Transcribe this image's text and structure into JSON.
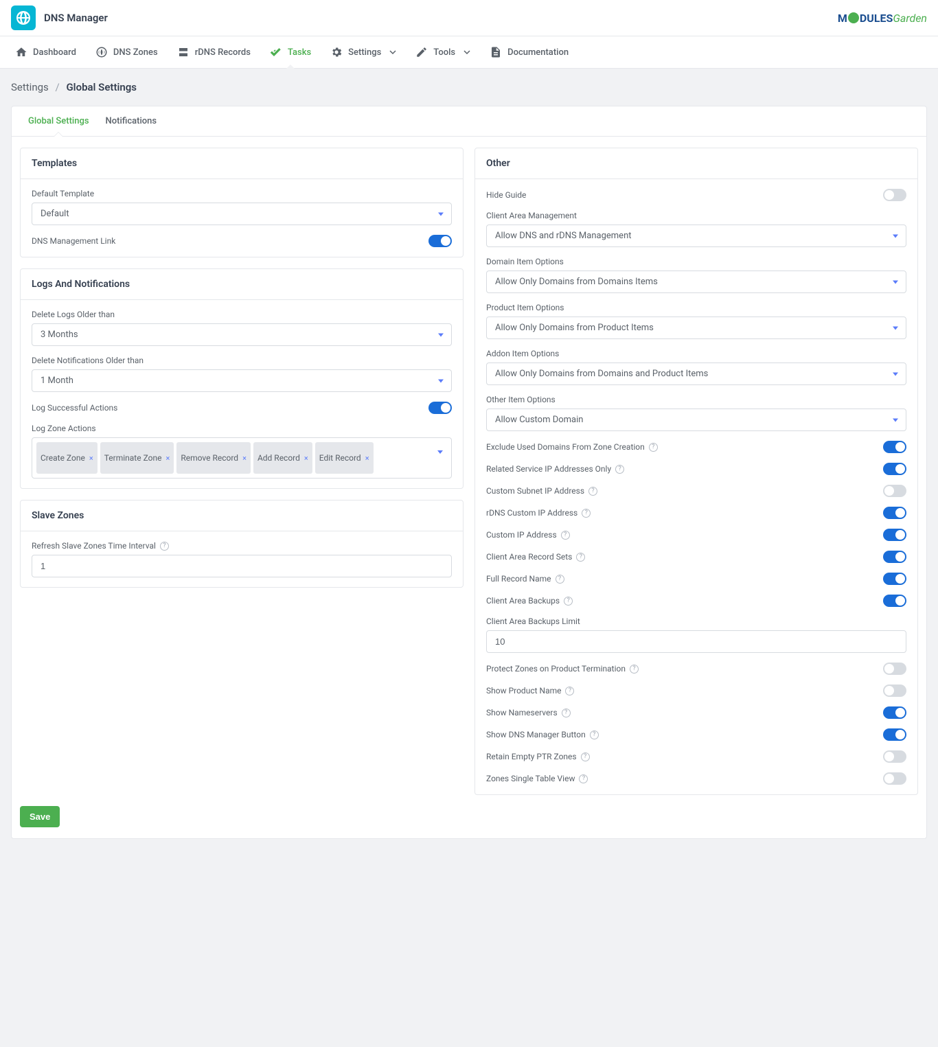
{
  "header": {
    "title": "DNS Manager",
    "logo_text1": "M",
    "logo_text2": "DULES",
    "logo_text3": "Garden"
  },
  "nav": {
    "dashboard": "Dashboard",
    "dns_zones": "DNS Zones",
    "rdns": "rDNS Records",
    "tasks": "Tasks",
    "settings": "Settings",
    "tools": "Tools",
    "docs": "Documentation"
  },
  "breadcrumb": {
    "root": "Settings",
    "current": "Global Settings"
  },
  "tabs": {
    "global": "Global Settings",
    "notifications": "Notifications"
  },
  "templates": {
    "title": "Templates",
    "default_template_label": "Default Template",
    "default_template_value": "Default",
    "dns_link_label": "DNS Management Link"
  },
  "logs": {
    "title": "Logs And Notifications",
    "del_logs_label": "Delete Logs Older than",
    "del_logs_value": "3 Months",
    "del_notif_label": "Delete Notifications Older than",
    "del_notif_value": "1 Month",
    "log_success_label": "Log Successful Actions",
    "log_zone_label": "Log Zone Actions",
    "tags": [
      "Create Zone",
      "Terminate Zone",
      "Remove Record",
      "Add Record",
      "Edit Record"
    ]
  },
  "slave": {
    "title": "Slave Zones",
    "refresh_label": "Refresh Slave Zones Time Interval",
    "refresh_value": "1"
  },
  "other": {
    "title": "Other",
    "hide_guide": "Hide Guide",
    "client_area_mgmt_label": "Client Area Management",
    "client_area_mgmt_value": "Allow DNS and rDNS Management",
    "domain_item_label": "Domain Item Options",
    "domain_item_value": "Allow Only Domains from Domains Items",
    "product_item_label": "Product Item Options",
    "product_item_value": "Allow Only Domains from Product Items",
    "addon_item_label": "Addon Item Options",
    "addon_item_value": "Allow Only Domains from Domains and Product Items",
    "other_item_label": "Other Item Options",
    "other_item_value": "Allow Custom Domain",
    "exclude_used": "Exclude Used Domains From Zone Creation",
    "related_ip": "Related Service IP Addresses Only",
    "custom_subnet": "Custom Subnet IP Address",
    "rdns_custom": "rDNS Custom IP Address",
    "custom_ip": "Custom IP Address",
    "record_sets": "Client Area Record Sets",
    "full_record": "Full Record Name",
    "backups": "Client Area Backups",
    "backups_limit_label": "Client Area Backups Limit",
    "backups_limit_value": "10",
    "protect_zones": "Protect Zones on Product Termination",
    "show_product": "Show Product Name",
    "show_ns": "Show Nameservers",
    "show_dns_btn": "Show DNS Manager Button",
    "retain_ptr": "Retain Empty PTR Zones",
    "single_table": "Zones Single Table View"
  },
  "save": "Save"
}
